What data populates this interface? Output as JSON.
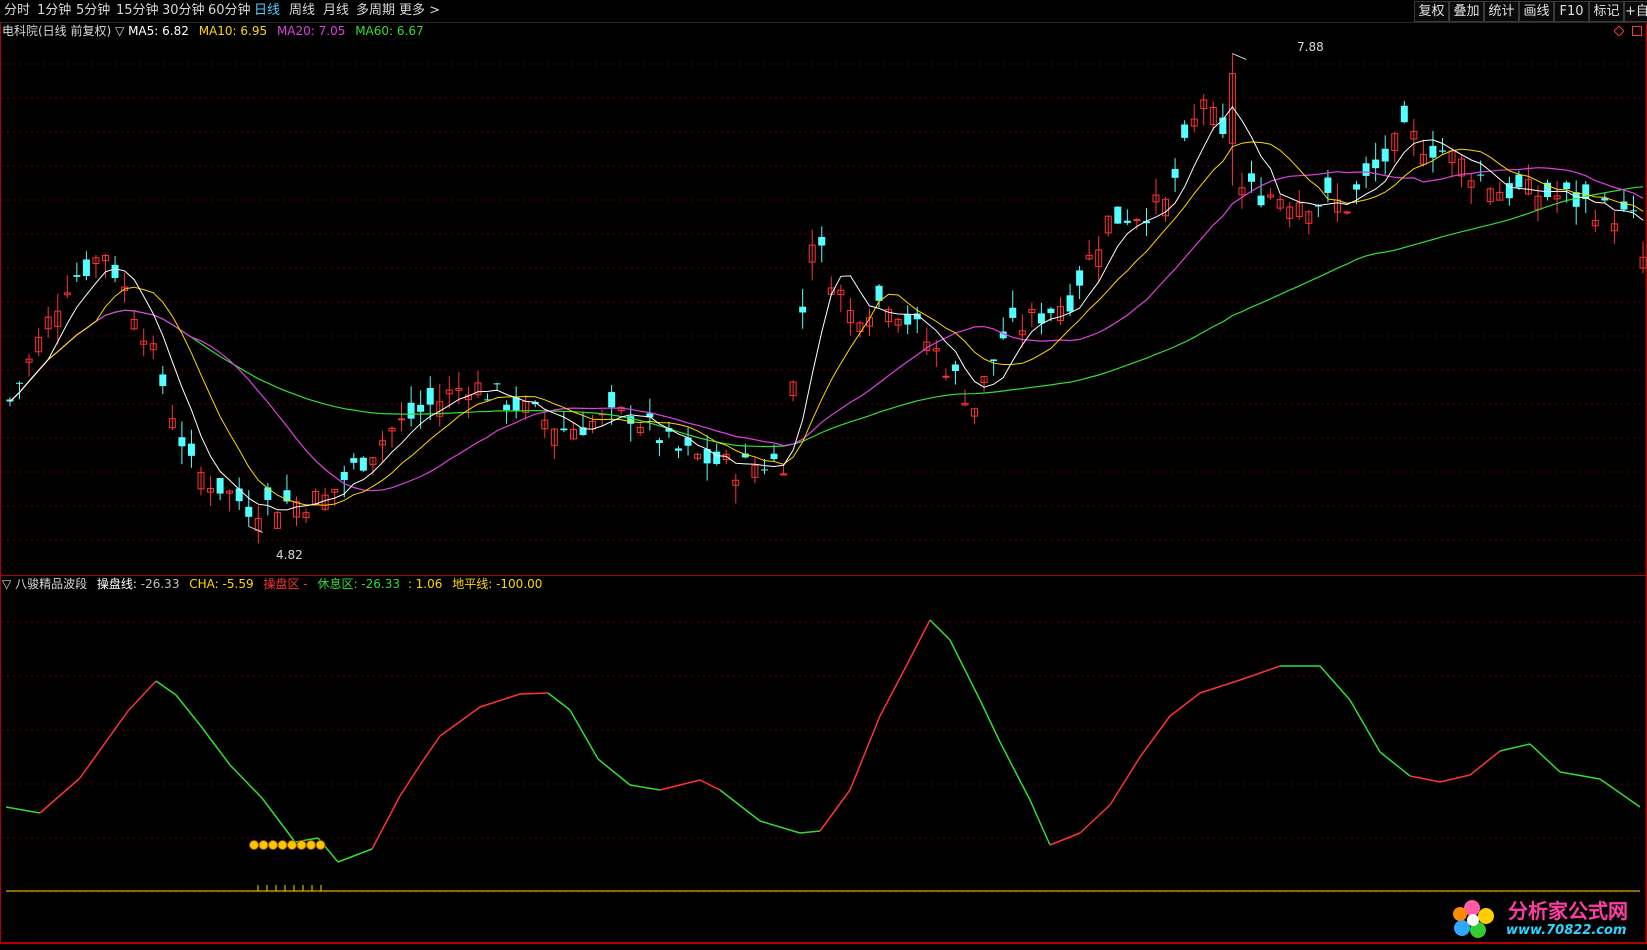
{
  "toolbar": {
    "periods": [
      "分时",
      "1分钟",
      "5分钟",
      "15分钟",
      "30分钟",
      "60分钟",
      "日线",
      "周线",
      "月线",
      "多周期",
      "更多 >"
    ],
    "active_period": "日线",
    "right_buttons": [
      "复权",
      "叠加",
      "统计",
      "画线",
      "F10",
      "标记",
      "+自"
    ]
  },
  "main_chart": {
    "stock_name": "电科院(日线 前复权)",
    "ma_toggle": "▽",
    "ma_labels": [
      {
        "label": "MA5: 6.82",
        "color": "#ffffff"
      },
      {
        "label": "MA10: 6.95",
        "color": "#ffd700"
      },
      {
        "label": "MA20: 7.05",
        "color": "#e040e0"
      },
      {
        "label": "MA60: 6.67",
        "color": "#33dd33"
      }
    ],
    "high_label": "7.88",
    "low_label": "4.82"
  },
  "indicator": {
    "toggle": "▽",
    "name": "八骏精品波段",
    "items": [
      {
        "label": "操盘线: ",
        "color": "#ffffff",
        "value": "-26.33",
        "vcolor": "#c0c0c0"
      },
      {
        "label": "CHA: ",
        "color": "#ffd700",
        "value": "-5.59",
        "vcolor": "#ffd700"
      },
      {
        "label": "操盘区 ",
        "color": "#ff3333",
        "value": "-",
        "vcolor": "#ff3333"
      },
      {
        "label": "休息区: ",
        "color": "#33dd33",
        "value": "-26.33",
        "vcolor": "#33dd33"
      },
      {
        "label": ": ",
        "color": "#ffd700",
        "value": "1.06",
        "vcolor": "#ffd700"
      },
      {
        "label": "地平线: ",
        "color": "#ffd700",
        "value": "-100.00",
        "vcolor": "#ffd700"
      }
    ]
  },
  "watermark": {
    "title": "分析家公式网",
    "url": "www.70822.com"
  },
  "colors": {
    "up": "#ff3333",
    "down": "#54ffff",
    "ma5": "#ffffff",
    "ma10": "#ffd700",
    "ma20": "#e040e0",
    "ma60": "#33dd33",
    "grid": "#8b0000"
  }
}
